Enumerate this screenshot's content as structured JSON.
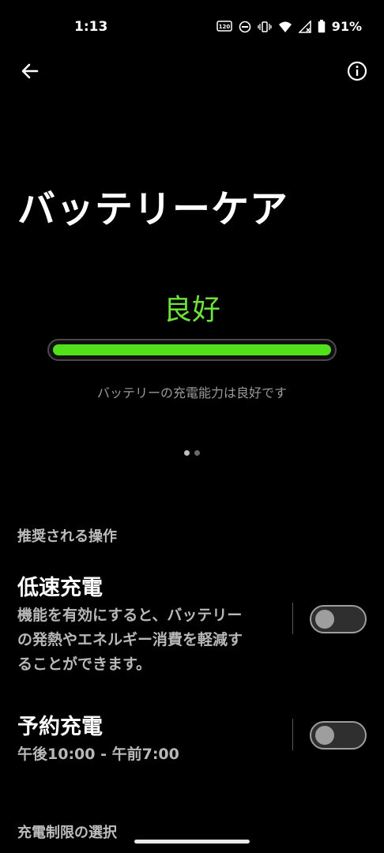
{
  "status_bar": {
    "time": "1:13",
    "battery_percent": "91%",
    "icons": [
      "hz-120-icon",
      "do-not-disturb-icon",
      "vibrate-icon",
      "wifi-icon",
      "cellular-no-signal-icon",
      "battery-icon"
    ]
  },
  "toolbar": {
    "back_icon": "arrow-left-icon",
    "info_icon": "info-icon"
  },
  "page": {
    "title": "バッテリーケア"
  },
  "health": {
    "status": "良好",
    "level_fraction": 1.0,
    "description": "バッテリーの充電能力は良好です",
    "color": "#52e01a"
  },
  "pager": {
    "count": 2,
    "active_index": 0
  },
  "recommended": {
    "header": "推奨される操作",
    "items": [
      {
        "title": "低速充電",
        "subtitle_lines": [
          "機能を有効にすると、バッテリー",
          "の発熱やエネルギー消費を軽減す",
          "ることができます。"
        ],
        "enabled": false
      },
      {
        "title": "予約充電",
        "subtitle_lines": [
          "午後10:00 - 午前7:00"
        ],
        "enabled": false
      }
    ]
  },
  "footer": {
    "section": "充電制限の選択"
  }
}
